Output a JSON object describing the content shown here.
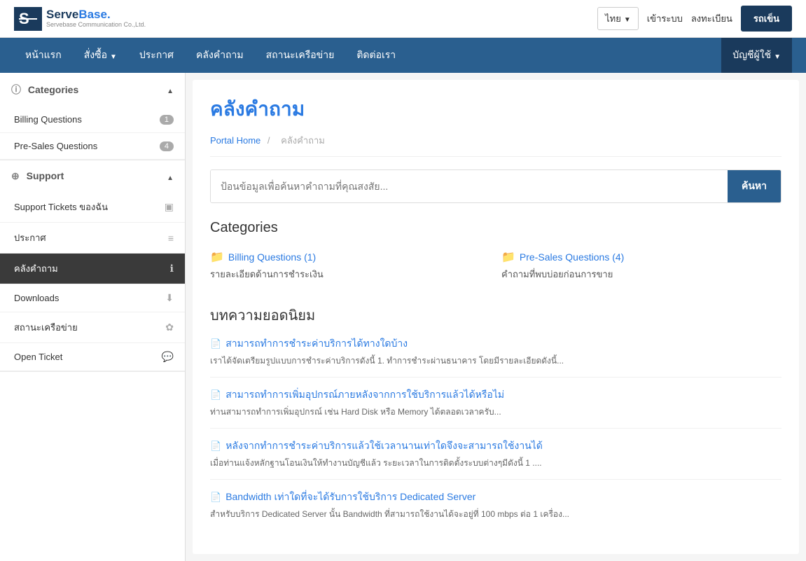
{
  "topbar": {
    "logo_company": "Servebase Communication Co.,Ltd.",
    "lang_label": "ไทย",
    "login_label": "เข้าระบบ",
    "register_label": "ลงทะเบียน",
    "join_label": "รถเข็น"
  },
  "navbar": {
    "items": [
      {
        "label": "หน้าแรก",
        "id": "home"
      },
      {
        "label": "สั่งซื้อ",
        "id": "order",
        "has_dropdown": true
      },
      {
        "label": "ประกาศ",
        "id": "announce"
      },
      {
        "label": "คลังคำถาม",
        "id": "faq"
      },
      {
        "label": "สถานะเครือข่าย",
        "id": "network"
      },
      {
        "label": "ติดต่อเรา",
        "id": "contact"
      }
    ],
    "account_label": "บัญชีผู้ใช้"
  },
  "sidebar": {
    "categories_label": "Categories",
    "categories": [
      {
        "label": "Billing Questions",
        "count": 1
      },
      {
        "label": "Pre-Sales Questions",
        "count": 4
      }
    ],
    "support_label": "Support",
    "support_items": [
      {
        "label": "Support Tickets ของฉัน",
        "icon": "ticket"
      },
      {
        "label": "ประกาศ",
        "icon": "list"
      },
      {
        "label": "คลังคำถาม",
        "icon": "info",
        "active": true
      },
      {
        "label": "Downloads",
        "icon": "download"
      },
      {
        "label": "สถานะเครือข่าย",
        "icon": "network"
      },
      {
        "label": "Open Ticket",
        "icon": "chat"
      }
    ]
  },
  "content": {
    "page_title": "คลังคำถาม",
    "breadcrumb_home": "Portal Home",
    "breadcrumb_current": "คลังคำถาม",
    "search_placeholder": "ป้อนข้อมูลเพื่อค้นหาคำถามที่คุณสงสัย...",
    "search_button": "ค้นหา",
    "categories_heading": "Categories",
    "categories": [
      {
        "title": "Billing Questions (1)",
        "desc": "รายละเอียดด้านการชำระเงิน"
      },
      {
        "title": "Pre-Sales Questions (4)",
        "desc": "คำถามที่พบบ่อยก่อนการขาย"
      }
    ],
    "popular_heading": "บทความยอดนิยม",
    "articles": [
      {
        "title": "สามารถทำการชำระค่าบริการได้ทางใดบ้าง",
        "excerpt": "เราได้จัดเตรียมรูปแบบการชำระค่าบริการดังนี้ 1. ทำการชำระผ่านธนาคาร โดยมีรายละเอียดดังนี้..."
      },
      {
        "title": "สามารถทำการเพิ่มอุปกรณ์ภายหลังจากการใช้บริการแล้วได้หรือไม่",
        "excerpt": "ท่านสามารถทำการเพิ่มอุปกรณ์ เช่น Hard Disk หรือ Memory ได้ตลอดเวลาครับ..."
      },
      {
        "title": "หลังจากทำการชำระค่าบริการแล้วใช้เวลานานเท่าใดจึงจะสามารถใช้งานได้",
        "excerpt": "เมื่อท่านแจ้งหลักฐานโอนเงินให้ทำงานบัญชีแล้ว ระยะเวลาในการติดตั้งระบบต่างๆมีดังนี้ 1 ...."
      },
      {
        "title": "Bandwidth เท่าใดที่จะได้รับการใช้บริการ Dedicated Server",
        "excerpt": "สำหรับบริการ Dedicated Server นั้น Bandwidth ที่สามารถใช้งานได้จะอยู่ที่ 100 mbps ต่อ 1 เครื่อง..."
      }
    ]
  }
}
